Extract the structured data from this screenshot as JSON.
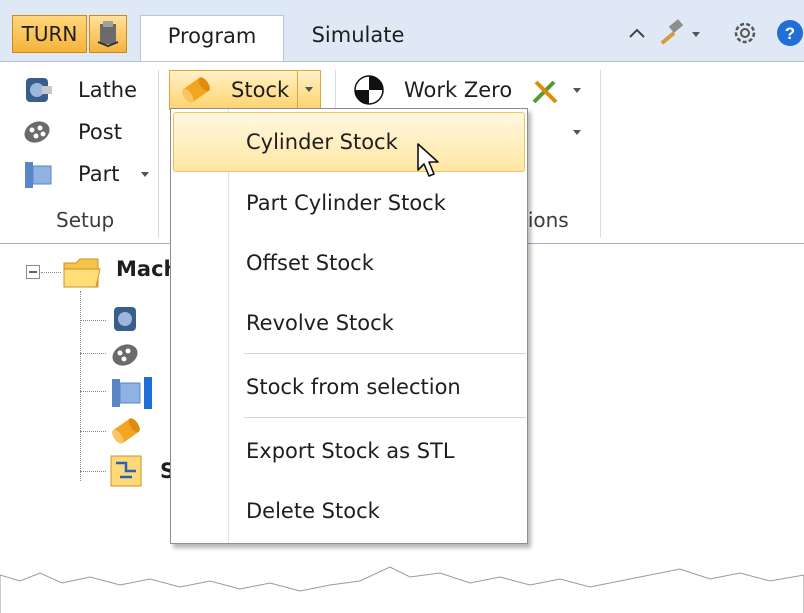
{
  "tabs": {
    "app_button": "TURN",
    "program": "Program",
    "simulate": "Simulate"
  },
  "quick_access": {
    "icons": [
      "chevron-up-icon",
      "hammer-icon",
      "dropdown-arrow-icon",
      "gear-icon",
      "help-icon"
    ]
  },
  "ribbon": {
    "setup": {
      "lathe": "Lathe",
      "post": "Post",
      "part": "Part",
      "group_label": "Setup"
    },
    "stock_label": "Stock",
    "work_zero_label": "Work Zero",
    "partial_group_label": "tions"
  },
  "tree": {
    "root_label_partial": "Mach",
    "last_item_partial": "S"
  },
  "stock_menu": {
    "items": [
      "Cylinder Stock",
      "Part Cylinder Stock",
      "Offset Stock",
      "Revolve Stock",
      "Stock from selection",
      "Export Stock as STL",
      "Delete Stock"
    ],
    "highlighted": "Cylinder Stock"
  },
  "colors": {
    "tab_strip": "#dfe9f5",
    "app_button": "#f6b23c",
    "highlight": "#ffe7a3",
    "help_blue": "#1f6fd6"
  }
}
